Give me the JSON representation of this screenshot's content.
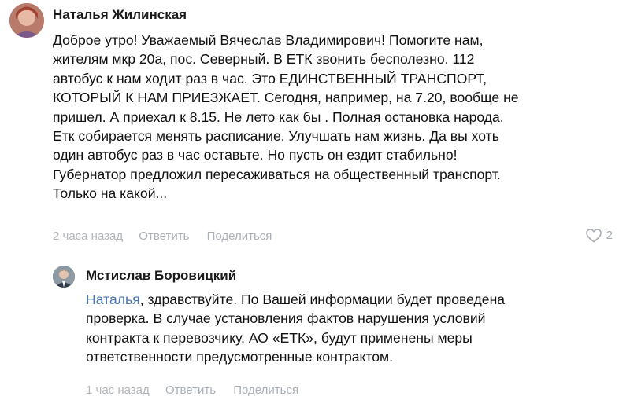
{
  "comment": {
    "author": "Наталья Жилинская",
    "lines": [
      "Доброе утро! Уважаемый Вячеслав Владимирович! Помогите нам,",
      "жителям мкр 20а, пос. Северный. В ЕТК звонить бесполезно. 112",
      "автобус к нам ходит раз в час. Это ЕДИНСТВЕННЫЙ ТРАНСПОРТ,",
      "КОТОРЫЙ К НАМ ПРИЕЗЖАЕТ. Сегодня, например, на 7.20, вообще не",
      "пришел. А приехал к 8.15. Не лето как бы . Полная остановка народа.",
      "Етк собирается менять расписание. Улучшать нам жизнь. Да вы хоть",
      "один автобус раз в час оставьте. Но пусть он ездит стабильно!",
      "Губернатор предложил пересаживаться на общественный транспорт.",
      "Только на какой..."
    ],
    "time": "2 часа назад",
    "reply_label": "Ответить",
    "share_label": "Поделиться",
    "likes_count": "2",
    "like_icon": "heart-outline-icon"
  },
  "reply": {
    "author": "Мстислав Боровицкий",
    "mention": "Наталья",
    "lines": [
      ", здравствуйте. По Вашей информации будет проведена",
      "проверка. В случае установления фактов нарушения условий",
      "контракта к перевозчику, АО «ЕТК», будут применены меры",
      "ответственности предусмотренные контрактом."
    ],
    "time": "1 час назад",
    "reply_label": "Ответить",
    "share_label": "Поделиться"
  },
  "colors": {
    "link": "#4a76a8",
    "meta": "#b2b6bb",
    "text": "#111111"
  }
}
